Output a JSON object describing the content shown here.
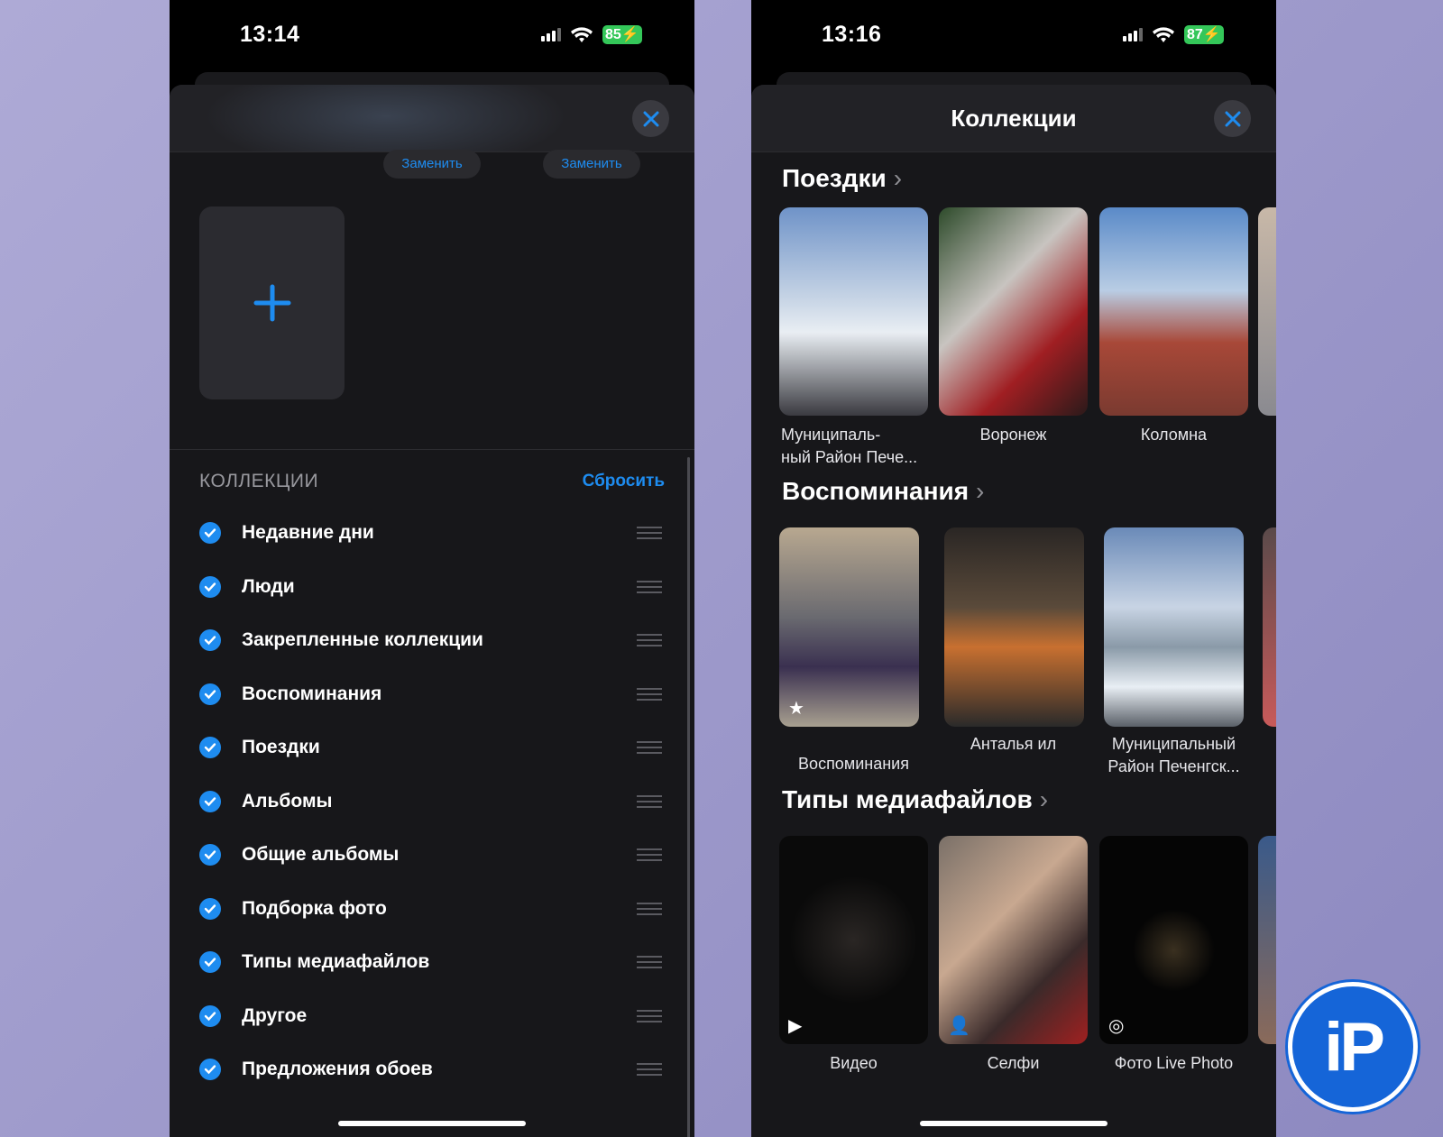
{
  "left": {
    "time": "13:14",
    "battery": "85",
    "replace_labels": [
      "Заменить",
      "Заменить"
    ],
    "section_header": "КОЛЛЕКЦИИ",
    "reset": "Сбросить",
    "items": [
      "Недавние дни",
      "Люди",
      "Закрепленные коллекции",
      "Воспоминания",
      "Поездки",
      "Альбомы",
      "Общие альбомы",
      "Подборка фото",
      "Типы медиафайлов",
      "Другое",
      "Предложения обоев"
    ]
  },
  "right": {
    "time": "13:16",
    "battery": "87",
    "title": "Коллекции",
    "sections": [
      {
        "title": "Поездки",
        "items": [
          "Муниципаль-\nный Район Пече...",
          "Воронеж",
          "Коломна"
        ]
      },
      {
        "title": "Воспоминания",
        "items": [
          "Воспоминания",
          "Анталья ил",
          "Муниципальный\nРайон Печенгск..."
        ]
      },
      {
        "title": "Типы медиафайлов",
        "items": [
          "Видео",
          "Селфи",
          "Фото Live Photo"
        ]
      }
    ]
  },
  "logo": "iP",
  "colors": {
    "accent": "#1e8cf0",
    "battery": "#34c759"
  }
}
